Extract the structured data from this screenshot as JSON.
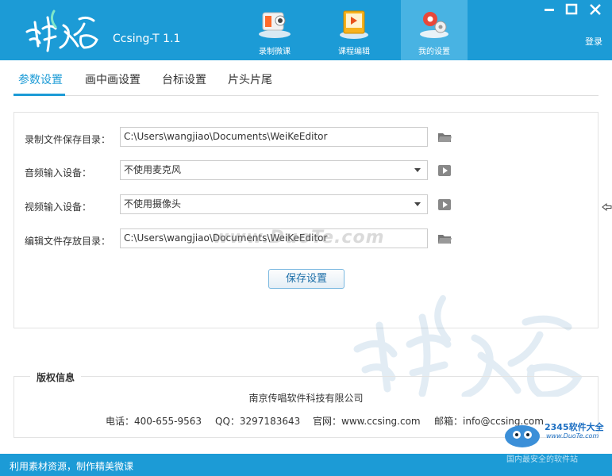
{
  "app": {
    "logo_text": "游学客",
    "title": "Ccsing-T 1.1",
    "login": "登录"
  },
  "nav": {
    "items": [
      {
        "label": "录制微课",
        "icon": "camera-icon"
      },
      {
        "label": "课程编辑",
        "icon": "course-edit-icon"
      },
      {
        "label": "我的设置",
        "icon": "settings-gears-icon"
      }
    ],
    "active_index": 2
  },
  "tabs": [
    "参数设置",
    "画中画设置",
    "台标设置",
    "片头片尾"
  ],
  "settings": {
    "record_dir_label": "录制文件保存目录：",
    "record_dir_value": "C:\\Users\\wangjiao\\Documents\\WeiKeEditor",
    "audio_label": "音频输入设备：",
    "audio_value": "不使用麦克风",
    "video_label": "视频输入设备：",
    "video_value": "不使用摄像头",
    "edit_dir_label": "编辑文件存放目录：",
    "edit_dir_value": "C:\\Users\\wangjiao\\Documents\\WeiKeEditor",
    "save_button": "保存设置"
  },
  "copyright": {
    "title": "版权信息",
    "company": "南京传唱软件科技有限公司",
    "phone": "电话：400-655-9563",
    "qq": "QQ：3297183643",
    "website": "官网：www.ccsing.com",
    "email": "邮箱：info@ccsing.com"
  },
  "watermark": {
    "domain": "www.DuoTe.com"
  },
  "badge": {
    "line1": "2345软件大全",
    "line2": "www.DuoTe.com",
    "line3": "国内最安全的软件站"
  },
  "status": {
    "text": "利用素材资源，制作精美微课"
  },
  "colors": {
    "primary": "#1c9bd6",
    "active_tab": "#48b3e3"
  }
}
